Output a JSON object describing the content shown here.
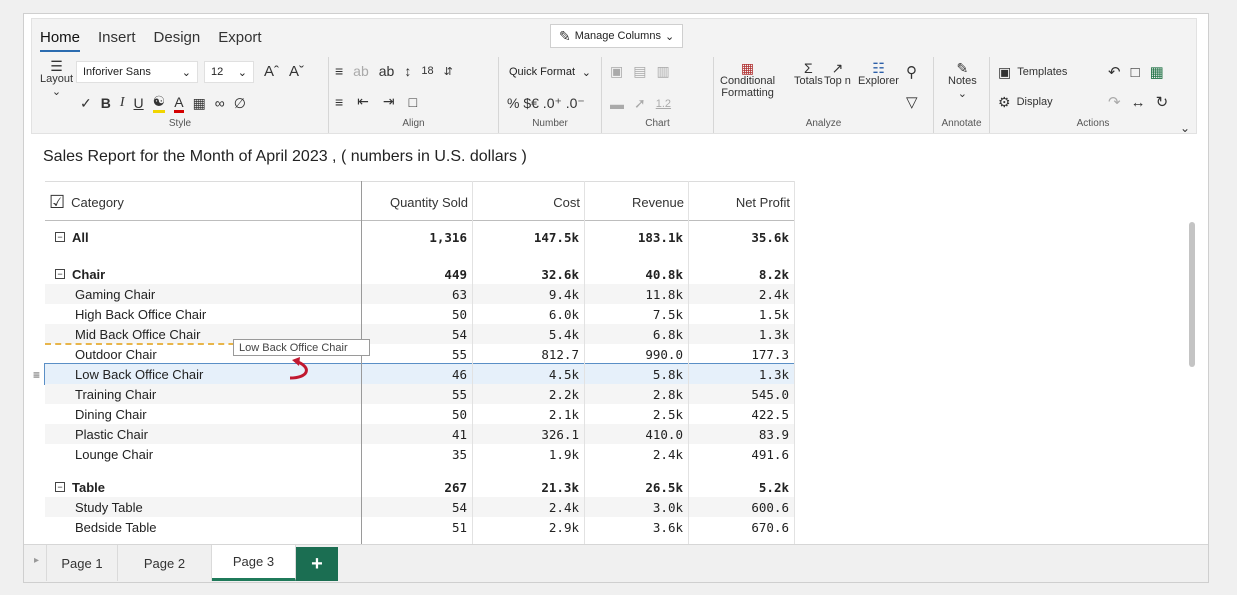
{
  "ribbon": {
    "tabs": [
      "Home",
      "Insert",
      "Design",
      "Export"
    ],
    "manage_columns": "Manage Columns",
    "layout_label": "Layout",
    "font_name": "Inforiver Sans",
    "font_size": "12",
    "line_height": "18",
    "quick_format": "Quick Format",
    "number_buttons": "% $€ .0⁺ .0⁻",
    "chart_num": "1.2",
    "conditional": "Conditional",
    "formatting": "Formatting",
    "totals": "Totals",
    "topn": "Top n",
    "explorer": "Explorer",
    "notes": "Notes",
    "templates": "Templates",
    "display": "Display",
    "groups": {
      "style": "Style",
      "align": "Align",
      "number": "Number",
      "chart": "Chart",
      "analyze": "Analyze",
      "annotate": "Annotate",
      "actions": "Actions"
    }
  },
  "report": {
    "title": "Sales Report for the Month of April 2023 , ( numbers in U.S. dollars )",
    "columns": [
      "Category",
      "Quantity Sold",
      "Cost",
      "Revenue",
      "Net Profit"
    ],
    "rows": [
      {
        "label": "All",
        "level": 0,
        "bold": true,
        "toggle": true,
        "values": [
          "1,316",
          "147.5k",
          "183.1k",
          "35.6k"
        ]
      },
      {
        "label": "Chair",
        "level": 0,
        "bold": true,
        "toggle": true,
        "values": [
          "449",
          "32.6k",
          "40.8k",
          "8.2k"
        ]
      },
      {
        "label": "Gaming Chair",
        "level": 1,
        "values": [
          "63",
          "9.4k",
          "11.8k",
          "2.4k"
        ]
      },
      {
        "label": "High Back Office Chair",
        "level": 1,
        "values": [
          "50",
          "6.0k",
          "7.5k",
          "1.5k"
        ]
      },
      {
        "label": "Mid Back Office Chair",
        "level": 1,
        "values": [
          "54",
          "5.4k",
          "6.8k",
          "1.3k"
        ]
      },
      {
        "label": "Outdoor Chair",
        "level": 1,
        "values": [
          "55",
          "812.7",
          "990.0",
          "177.3"
        ]
      },
      {
        "label": "Low Back Office Chair",
        "level": 1,
        "selected": true,
        "values": [
          "46",
          "4.5k",
          "5.8k",
          "1.3k"
        ]
      },
      {
        "label": "Training Chair",
        "level": 1,
        "values": [
          "55",
          "2.2k",
          "2.8k",
          "545.0"
        ]
      },
      {
        "label": "Dining Chair",
        "level": 1,
        "values": [
          "50",
          "2.1k",
          "2.5k",
          "422.5"
        ]
      },
      {
        "label": "Plastic Chair",
        "level": 1,
        "values": [
          "41",
          "326.1",
          "410.0",
          "83.9"
        ]
      },
      {
        "label": "Lounge Chair",
        "level": 1,
        "values": [
          "35",
          "1.9k",
          "2.4k",
          "491.6"
        ]
      },
      {
        "label": "Table",
        "level": 0,
        "bold": true,
        "toggle": true,
        "values": [
          "267",
          "21.3k",
          "26.5k",
          "5.2k"
        ]
      },
      {
        "label": "Study Table",
        "level": 1,
        "values": [
          "54",
          "2.4k",
          "3.0k",
          "600.6"
        ]
      },
      {
        "label": "Bedside Table",
        "level": 1,
        "values": [
          "51",
          "2.9k",
          "3.6k",
          "670.6"
        ]
      }
    ],
    "drag_tooltip": "Low Back Office Chair"
  },
  "pages": [
    "Page 1",
    "Page 2",
    "Page 3"
  ],
  "active_page": "Page 3",
  "add_page": "+"
}
